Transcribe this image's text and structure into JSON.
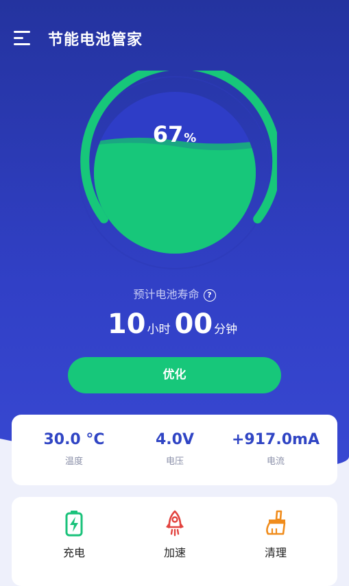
{
  "header": {
    "title": "节能电池管家"
  },
  "battery": {
    "percent_value": "67",
    "percent_unit": "%",
    "level": 0.67
  },
  "life": {
    "label": "预计电池寿命",
    "help_glyph": "?",
    "hours": "10",
    "hours_unit": "小时",
    "minutes": "00",
    "minutes_unit": "分钟"
  },
  "optimize_button": {
    "label": "优化"
  },
  "stats": [
    {
      "value": "30.0 °C",
      "label": "温度"
    },
    {
      "value": "4.0V",
      "label": "电压"
    },
    {
      "value": "+917.0mA",
      "label": "电流"
    }
  ],
  "tools": [
    {
      "label": "充电",
      "icon": "charging-battery-icon"
    },
    {
      "label": "加速",
      "icon": "rocket-icon"
    },
    {
      "label": "清理",
      "icon": "brush-icon"
    }
  ],
  "colors": {
    "primary_blue": "#2b39b8",
    "accent_green": "#17c77a",
    "stat_value": "#3045c4",
    "charge_icon": "#19c27a",
    "rocket_icon": "#e2433f",
    "brush_icon": "#f08c1c"
  }
}
